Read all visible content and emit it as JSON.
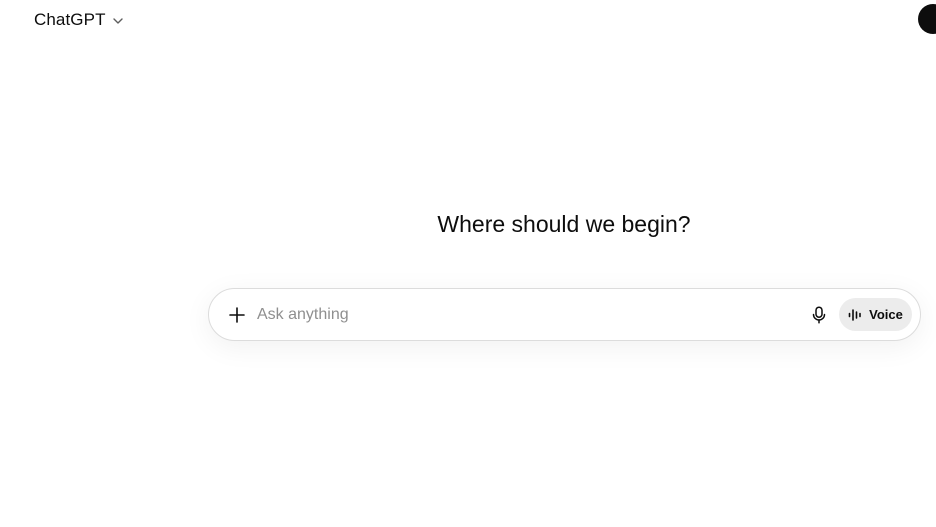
{
  "header": {
    "model_name": "ChatGPT",
    "model_menu_icon": "chevron-down-icon",
    "avatar_icon": "user-avatar"
  },
  "main": {
    "greeting": "Where should we begin?"
  },
  "composer": {
    "placeholder": "Ask anything",
    "value": "",
    "attach_icon": "plus-icon",
    "dictate_icon": "microphone-icon",
    "voice_label": "Voice",
    "voice_icon": "voice-waveform-icon"
  },
  "colors": {
    "text": "#0d0d0d",
    "placeholder": "#8f8f8f",
    "voice_button_bg": "#ececec",
    "composer_border": "#dcdcdc"
  }
}
